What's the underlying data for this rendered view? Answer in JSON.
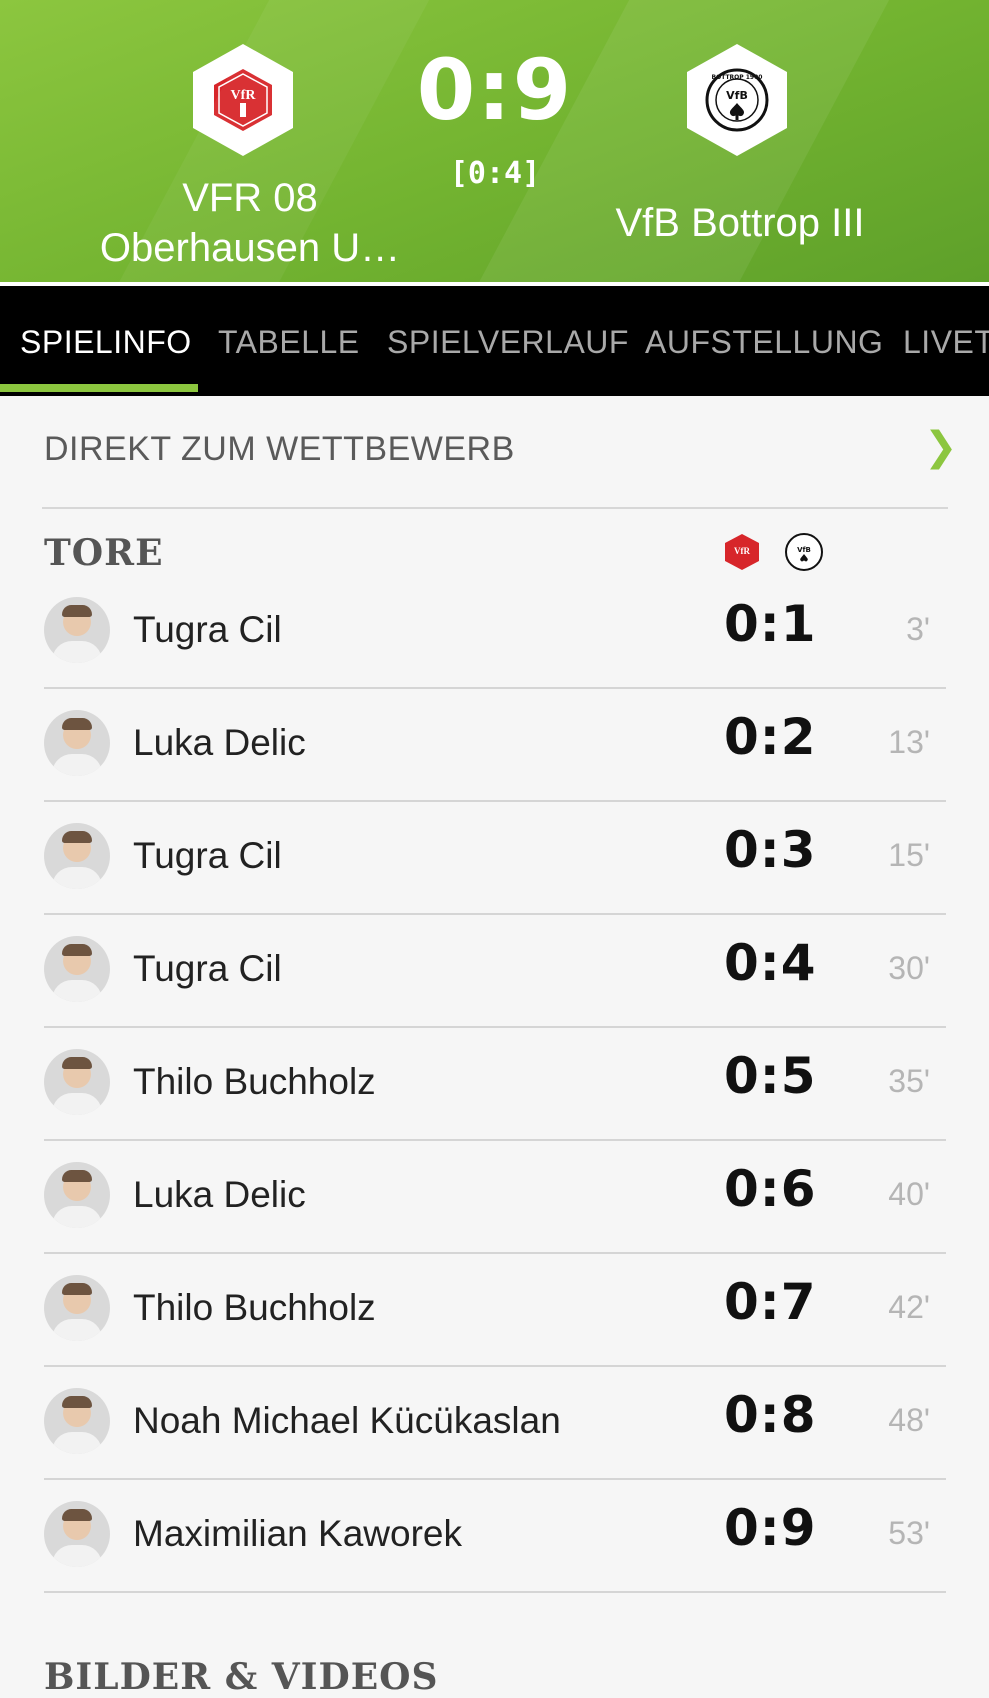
{
  "header": {
    "score": "0:9",
    "halftime": "[0:4]",
    "home_team": "VFR 08 Oberhausen U…",
    "away_team": "VfB Bottrop III",
    "home_logo_text": "VfR",
    "away_logo_text": "VfB",
    "away_logo_ring": "BOTTROP 1900"
  },
  "tabs": [
    "SPIELINFO",
    "TABELLE",
    "SPIELVERLAUF",
    "AUFSTELLUNG",
    "LIVET"
  ],
  "active_tab": "SPIELINFO",
  "competition_link": "DIREKT ZUM WETTBEWERB",
  "goals_section": {
    "title": "TORE",
    "goals": [
      {
        "scorer": "Tugra Cil",
        "score": "0:1",
        "minute": "3'"
      },
      {
        "scorer": "Luka Delic",
        "score": "0:2",
        "minute": "13'"
      },
      {
        "scorer": "Tugra Cil",
        "score": "0:3",
        "minute": "15'"
      },
      {
        "scorer": "Tugra Cil",
        "score": "0:4",
        "minute": "30'"
      },
      {
        "scorer": "Thilo Buchholz",
        "score": "0:5",
        "minute": "35'"
      },
      {
        "scorer": "Luka Delic",
        "score": "0:6",
        "minute": "40'"
      },
      {
        "scorer": "Thilo Buchholz",
        "score": "0:7",
        "minute": "42'"
      },
      {
        "scorer": "Noah Michael Kücükaslan",
        "score": "0:8",
        "minute": "48'"
      },
      {
        "scorer": "Maximilian Kaworek",
        "score": "0:9",
        "minute": "53'"
      }
    ]
  },
  "media_section": {
    "title": "BILDER & VIDEOS"
  },
  "colors": {
    "accent": "#8cc63f",
    "tab_bar": "#000000",
    "home_red": "#d7262a"
  },
  "icons": {
    "link_arrow": "chevron-right-icon"
  }
}
